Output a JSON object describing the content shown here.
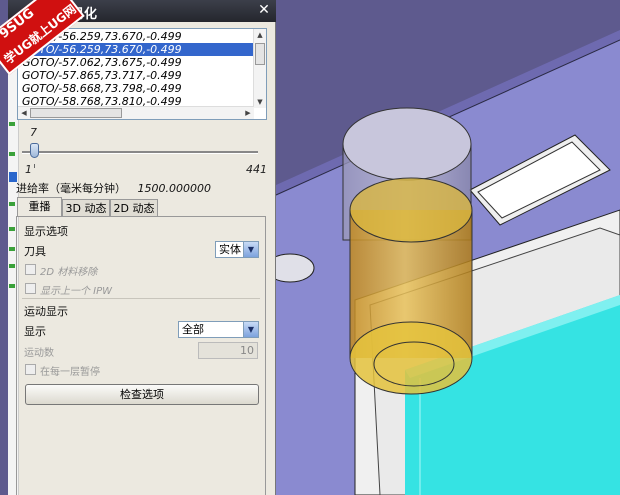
{
  "dialog": {
    "title": "视化",
    "close_symbol": "✕"
  },
  "watermark": {
    "line1": "9SUG",
    "line2": "学UG就上UG网"
  },
  "toolpath_list": {
    "items": [
      "GOTO/-56.259,73.670,-0.499",
      "GOTO/-56.259,73.670,-0.499",
      "GOTO/-57.062,73.675,-0.499",
      "GOTO/-57.865,73.717,-0.499",
      "GOTO/-58.668,73.798,-0.499",
      "GOTO/-58.768,73.810,-0.499"
    ],
    "selected_index": 1,
    "scroll_up": "▲",
    "scroll_down": "▼",
    "scroll_left": "◀",
    "scroll_right": "▶"
  },
  "slider": {
    "current_value": "7",
    "min_label": "1",
    "max_label": "441",
    "position_fraction": 0.014
  },
  "feed_rate": {
    "label": "进给率（毫米每分钟）",
    "value": "1500.000000"
  },
  "tabs": [
    {
      "label": "重播",
      "active": true
    },
    {
      "label": "3D 动态",
      "active": false
    },
    {
      "label": "2D 动态",
      "active": false
    }
  ],
  "display_options": {
    "section_label": "显示选项",
    "tool_label": "刀具",
    "tool_value": "实体",
    "material_removal_2d": "2D 材料移除",
    "show_previous_ipw": "显示上一个 IPW"
  },
  "motion_display": {
    "section_label": "运动显示",
    "display_label": "显示",
    "display_value": "全部",
    "motion_count_label": "运动数",
    "motion_count_value": "10",
    "pause_each_layer": "在每一层暂停"
  },
  "check_options_button": "检查选项",
  "colors": {
    "selection": "#3366cc",
    "viewport_bg": "#5e5a8e",
    "part_face": "#8a8ad0",
    "stock_cyan": "#35e3e3",
    "tool_gold": "#d7a52c"
  }
}
